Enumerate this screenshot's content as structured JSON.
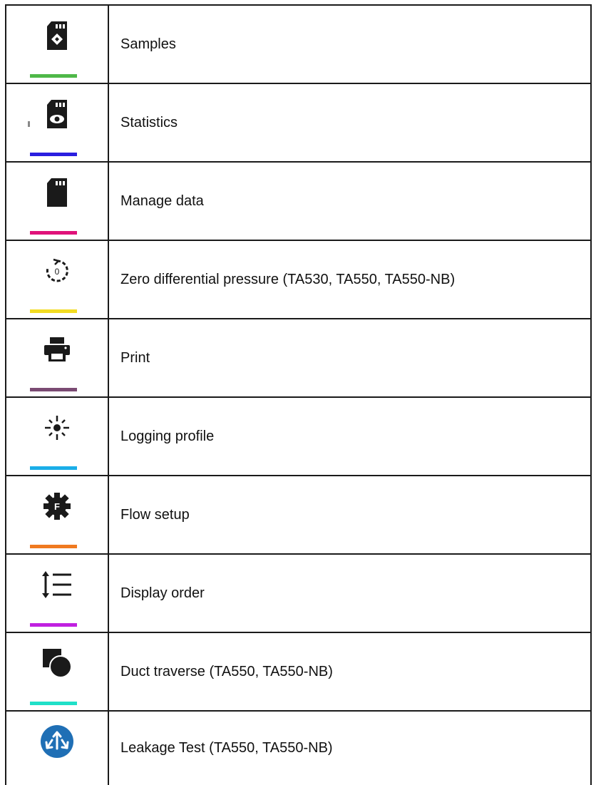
{
  "items": [
    {
      "label": "Samples",
      "icon": "sd-card-diamond-icon",
      "color": "#4fb848"
    },
    {
      "label": "Statistics",
      "icon": "sd-card-eye-icon",
      "color": "#2a1ee0"
    },
    {
      "label": "Manage data",
      "icon": "sd-card-icon",
      "color": "#e0127a"
    },
    {
      "label": "Zero differential pressure (TA530, TA550, TA550-NB)",
      "icon": "zero-reset-icon",
      "color": "#f2dc22"
    },
    {
      "label": "Print",
      "icon": "printer-icon",
      "color": "#7a4a73"
    },
    {
      "label": "Logging profile",
      "icon": "logging-profile-icon",
      "color": "#1aaee8"
    },
    {
      "label": "Flow setup",
      "icon": "flow-setup-gear-icon",
      "color": "#f07a20"
    },
    {
      "label": "Display order",
      "icon": "display-order-icon",
      "color": "#c020e0"
    },
    {
      "label": "Duct traverse (TA550, TA550-NB)",
      "icon": "duct-traverse-icon",
      "color": "#20e0c8"
    },
    {
      "label": "Leakage Test (TA550, TA550-NB)",
      "icon": "leakage-test-icon",
      "color": "#1f6fb5"
    }
  ]
}
